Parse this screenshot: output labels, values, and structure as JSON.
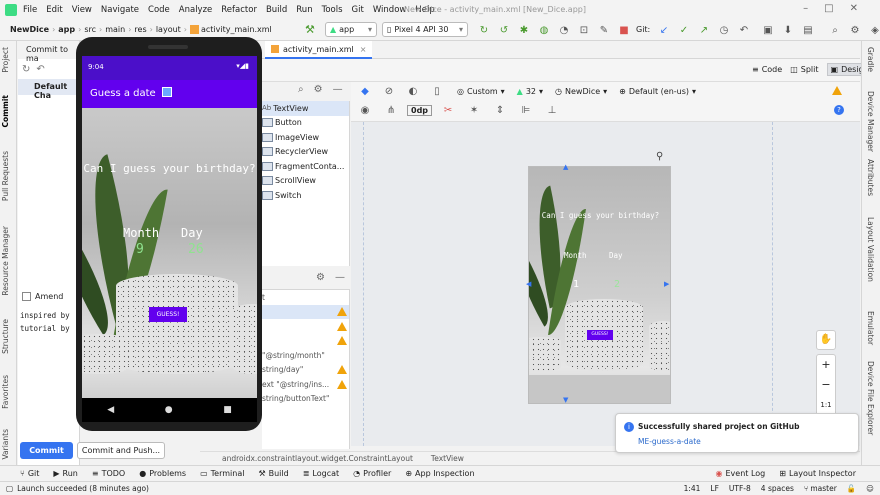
{
  "titlebar": {
    "menu": [
      "File",
      "Edit",
      "View",
      "Navigate",
      "Code",
      "Analyze",
      "Refactor",
      "Build",
      "Run",
      "Tools",
      "Git",
      "Window",
      "Help"
    ],
    "window_title": "New Dice - activity_main.xml [New_Dice.app]"
  },
  "navbar": {
    "crumbs": [
      "NewDice",
      "app",
      "src",
      "main",
      "res",
      "layout",
      "activity_main.xml"
    ],
    "run_config": "app",
    "device": "Pixel 4 API 30",
    "git_label": "Git:"
  },
  "left_tabs": [
    "Project",
    "Commit",
    "Pull Requests",
    "Resource Manager",
    "Structure",
    "Favorites",
    "Variants"
  ],
  "right_tabs": [
    "Gradle",
    "Device Manager",
    "Attributes",
    "Layout Validation",
    "Emulator",
    "Device File Explorer"
  ],
  "commit": {
    "header": "Commit to ma",
    "changelist": "Default Cha",
    "amend": "Amend",
    "message_lines": [
      "inspired by",
      "tutorial by"
    ],
    "commit_button": "Commit",
    "commit_push_button": "Commit and Push..."
  },
  "editor": {
    "tab": "activity_main.xml",
    "view_modes": [
      "Code",
      "Split",
      "Design"
    ]
  },
  "palette": {
    "items": [
      "TextView",
      "Button",
      "ImageView",
      "RecyclerView",
      "FragmentConta...",
      "ScrollView",
      "Switch"
    ]
  },
  "tree": {
    "items": [
      "t",
      "",
      "",
      "\"@string/month\"",
      "string/day\"",
      "ext  \"@string/ins...",
      "string/buttonText\""
    ]
  },
  "design_toolbar": {
    "theme": "Custom",
    "api": "32",
    "activity": "NewDice",
    "locale": "Default (en-us)",
    "margin": "0dp"
  },
  "preview": {
    "question": "Can I guess your birthday?",
    "month_label": "Month",
    "day_label": "Day",
    "month_value": "1",
    "day_value": "2",
    "button": "GUESS!"
  },
  "emulator": {
    "time": "9:04",
    "app_title": "Guess a date",
    "question": "Can I guess your birthday?",
    "month_label": "Month",
    "day_label": "Day",
    "month_value": "9",
    "day_value": "26",
    "button": "GUESS!"
  },
  "zoom": {
    "ratio": "1:1"
  },
  "path_bar": {
    "path": "androidx.constraintlayout.widget.ConstraintLayout",
    "leaf": "TextView"
  },
  "notification": {
    "title": "Successfully shared project on GitHub",
    "link": "ME-guess-a-date"
  },
  "bottom_tools": [
    "Git",
    "Run",
    "TODO",
    "Problems",
    "Terminal",
    "Build",
    "Logcat",
    "Profiler",
    "App Inspection"
  ],
  "bottom_tools_right": [
    "Event Log",
    "Layout Inspector"
  ],
  "footer": {
    "message": "Launch succeeded (8 minutes ago)",
    "position": "1:41",
    "line_sep": "LF",
    "encoding": "UTF-8",
    "indent": "4 spaces",
    "branch": "master"
  },
  "colors": {
    "accent": "#3574f0",
    "app_purple": "#6200ee",
    "status_purple": "#4b0fc9",
    "value_green": "#8fe38f",
    "warning": "#f0a30a"
  }
}
